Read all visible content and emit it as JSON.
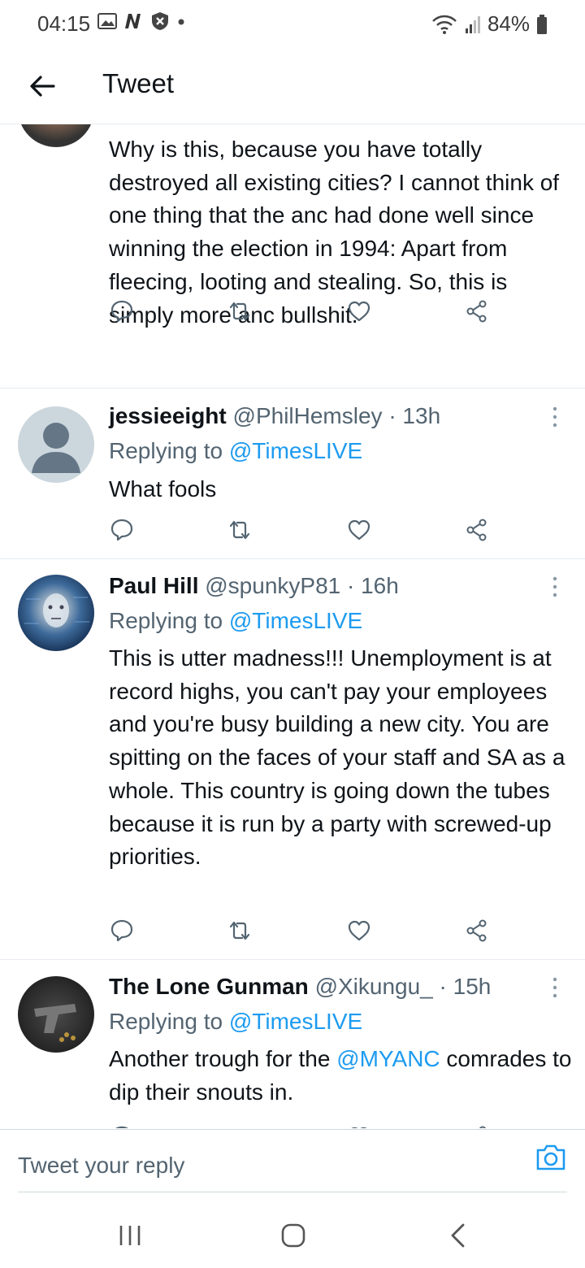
{
  "status_bar": {
    "time": "04:15",
    "battery": "84%",
    "icons": [
      "gallery-icon",
      "netflix-n-icon",
      "shield-x-icon",
      "dot-icon",
      "wifi-icon",
      "signal-icon",
      "battery-icon"
    ]
  },
  "app_bar": {
    "title": "Tweet"
  },
  "tweets": [
    {
      "body": "Why is this, because you have totally destroyed all existing cities? I cannot think of one thing that the anc had done well since winning the election in 1994: Apart from fleecing, looting and stealing. So, this is simply more anc bullshit."
    },
    {
      "name": "jessieeight",
      "handle": "@PhilHemsley",
      "time": "· 13h",
      "replying_prefix": "Replying to ",
      "replying_handle": "@TimesLIVE",
      "body": "What fools"
    },
    {
      "name": "Paul Hill",
      "handle": "@spunkyP81",
      "time": "· 16h",
      "replying_prefix": "Replying to ",
      "replying_handle": "@TimesLIVE",
      "body": "This is utter madness!!! Unemployment is at record highs, you can't pay your employees and you're busy building a new city. You are spitting on the faces of your staff and SA as a whole. This country is going down the tubes because it is run by a party with screwed-up priorities."
    },
    {
      "name": "The Lone Gunman",
      "handle": "@Xikungu_",
      "time": "· 15h",
      "replying_prefix": "Replying to ",
      "replying_handle": "@TimesLIVE",
      "body_before": "Another trough for the ",
      "body_mention": "@MYANC",
      "body_after": " comrades to dip their snouts in."
    }
  ],
  "compose": {
    "placeholder": "Tweet your reply"
  },
  "colors": {
    "accent": "#1d9bf0",
    "secondary_text": "#536471",
    "primary_text": "#0f1419",
    "divider": "#e6ecf0"
  }
}
